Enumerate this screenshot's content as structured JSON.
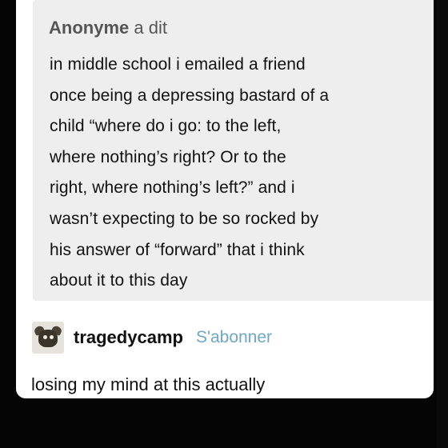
{
  "ask": {
    "asker": "Anonyme",
    "said": "a dit",
    "lines": [
      "in middle school i emailed a friend",
      "once being a depressing bastard of a",
      "child “where do i go: to the left,",
      "where nothing’s right? Or to the",
      "right, where nothing’s left?” and i",
      "wasn’t expecting to be so rocked by",
      "his answer of “forward” that i think",
      "about it to this day"
    ]
  },
  "reblog": {
    "avatar_icon": "cat-avatar-icon",
    "username": "tragedycamp",
    "follow_label": "S'abonner",
    "text": "losing my mind at this actually"
  },
  "colors": {
    "background": "#050505",
    "card": "#ffffff",
    "ask_box": "#eeeeee",
    "follow_link": "#6fa8c6"
  }
}
